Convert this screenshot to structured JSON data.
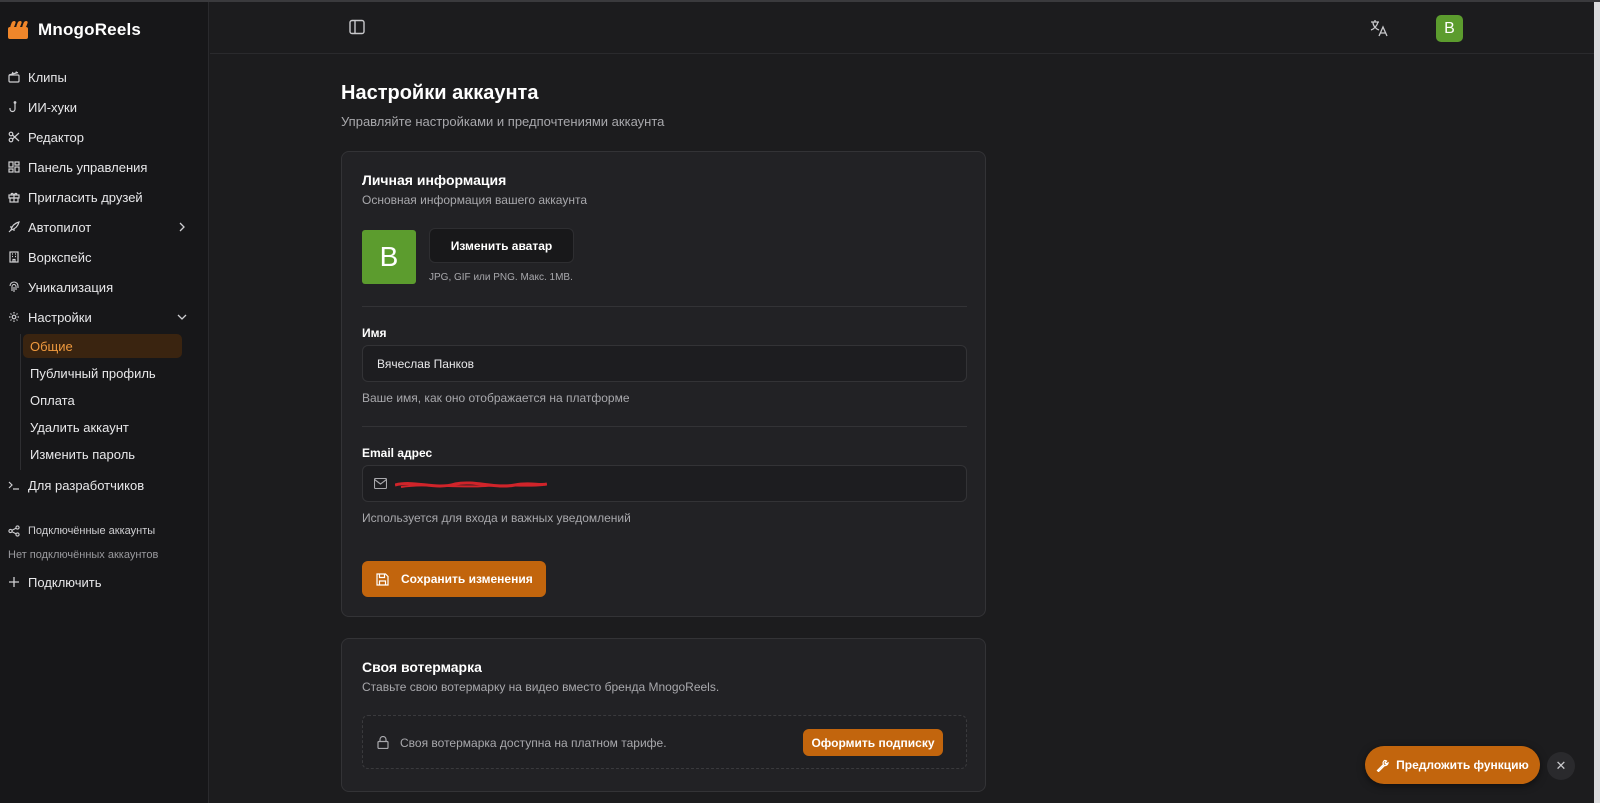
{
  "app": {
    "name": "MnogoReels",
    "user_initial": "B",
    "accent_color": "#c2650d",
    "avatar_color": "#5c9c2e"
  },
  "sidebar": {
    "items": [
      {
        "label": "Клипы",
        "icon": "clapperboard-icon"
      },
      {
        "label": "ИИ-хуки",
        "icon": "hook-icon"
      },
      {
        "label": "Редактор",
        "icon": "scissors-icon"
      },
      {
        "label": "Панель управления",
        "icon": "dashboard-icon"
      },
      {
        "label": "Пригласить друзей",
        "icon": "gift-icon"
      },
      {
        "label": "Автопилот",
        "icon": "rocket-icon"
      },
      {
        "label": "Воркспейс",
        "icon": "building-icon"
      },
      {
        "label": "Уникализация",
        "icon": "fingerprint-icon"
      },
      {
        "label": "Настройки",
        "icon": "gear-icon"
      }
    ],
    "settings_sub": [
      {
        "label": "Общие",
        "active": true
      },
      {
        "label": "Публичный профиль"
      },
      {
        "label": "Оплата"
      },
      {
        "label": "Удалить аккаунт"
      },
      {
        "label": "Изменить пароль"
      }
    ],
    "developers": "Для разработчиков",
    "connected_title": "Подключённые аккаунты",
    "connected_empty": "Нет подключённых аккаунтов",
    "connect_label": "Подключить"
  },
  "page": {
    "title": "Настройки аккаунта",
    "subtitle": "Управляйте настройками и предпочтениями аккаунта"
  },
  "personal": {
    "title": "Личная информация",
    "desc": "Основная информация вашего аккаунта",
    "change_avatar": "Изменить аватар",
    "avatar_hint": "JPG, GIF или PNG. Макс. 1MB.",
    "name_label": "Имя",
    "name_value": "Вячеслав Панков",
    "name_hint": "Ваше имя, как оно отображается на платформе",
    "email_label": "Email адрес",
    "email_hint": "Используется для входа и важных уведомлений",
    "save_label": "Сохранить изменения"
  },
  "watermark": {
    "title": "Своя вотермарка",
    "desc": "Ставьте свою вотермарку на видео вместо бренда MnogoReels.",
    "locked_text": "Своя вотермарка доступна на платном тарифе.",
    "subscribe_label": "Оформить подписку"
  },
  "floating": {
    "feature_label": "Предложить функцию",
    "close_symbol": "✕"
  }
}
